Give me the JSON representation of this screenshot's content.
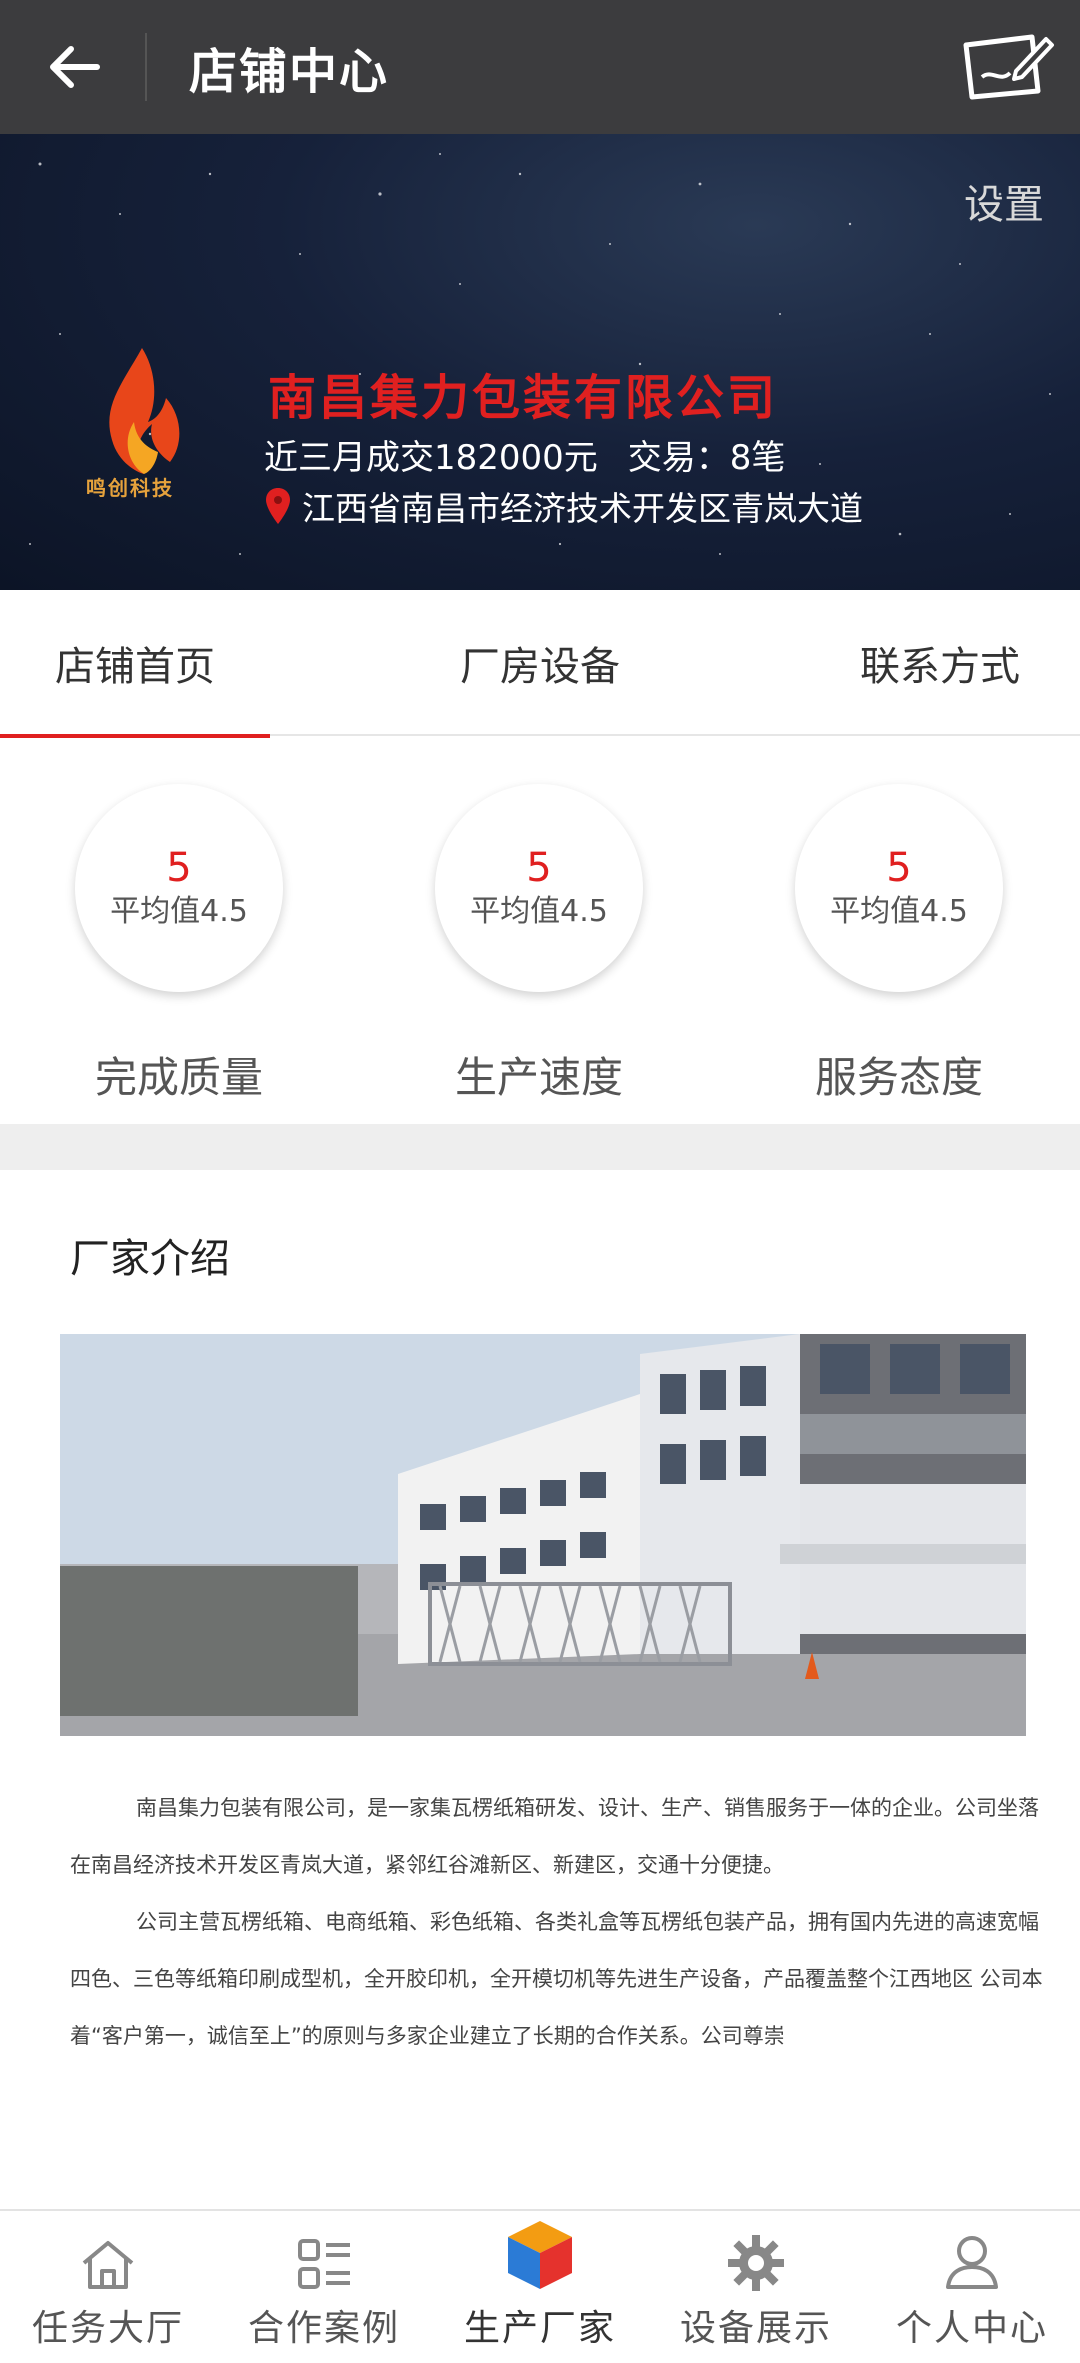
{
  "appbar": {
    "title": "店铺中心"
  },
  "banner": {
    "settings_label": "设置",
    "logo_text": "鸣创科技",
    "company_name": "南昌集力包装有限公司",
    "recent_sales": "近三月成交182000元",
    "trades": "交易：8笔",
    "address": "江西省南昌市经济技术开发区青岚大道"
  },
  "tabs": [
    {
      "label": "店铺首页",
      "active": true
    },
    {
      "label": "厂房设备",
      "active": false
    },
    {
      "label": "联系方式",
      "active": false
    }
  ],
  "ratings": [
    {
      "score": "5",
      "avg": "平均值4.5",
      "label": "完成质量"
    },
    {
      "score": "5",
      "avg": "平均值4.5",
      "label": "生产速度"
    },
    {
      "score": "5",
      "avg": "平均值4.5",
      "label": "服务态度"
    }
  ],
  "intro": {
    "title": "厂家介绍",
    "paragraphs": [
      "南昌集力包装有限公司，是一家集瓦楞纸箱研发、设计、生产、销售服务于一体的企业。公司坐落在南昌经济技术开发区青岚大道，紧邻红谷滩新区、新建区，交通十分便捷。",
      "公司主营瓦楞纸箱、电商纸箱、彩色纸箱、各类礼盒等瓦楞纸包装产品，拥有国内先进的高速宽幅四色、三色等纸箱印刷成型机，全开胶印机，全开模切机等先进生产设备，产品覆盖整个江西地区 公司本着“客户第一，诚信至上”的原则与多家企业建立了长期的合作关系。公司尊崇"
    ]
  },
  "bottom_nav": [
    {
      "label": "任务大厅",
      "icon": "home-icon"
    },
    {
      "label": "合作案例",
      "icon": "list-icon"
    },
    {
      "label": "生产厂家",
      "icon": "cube-icon"
    },
    {
      "label": "设备展示",
      "icon": "gear-icon"
    },
    {
      "label": "个人中心",
      "icon": "user-icon"
    }
  ],
  "colors": {
    "accent": "#e02020",
    "appbar": "#3c3c3e",
    "banner": "#16213a"
  }
}
